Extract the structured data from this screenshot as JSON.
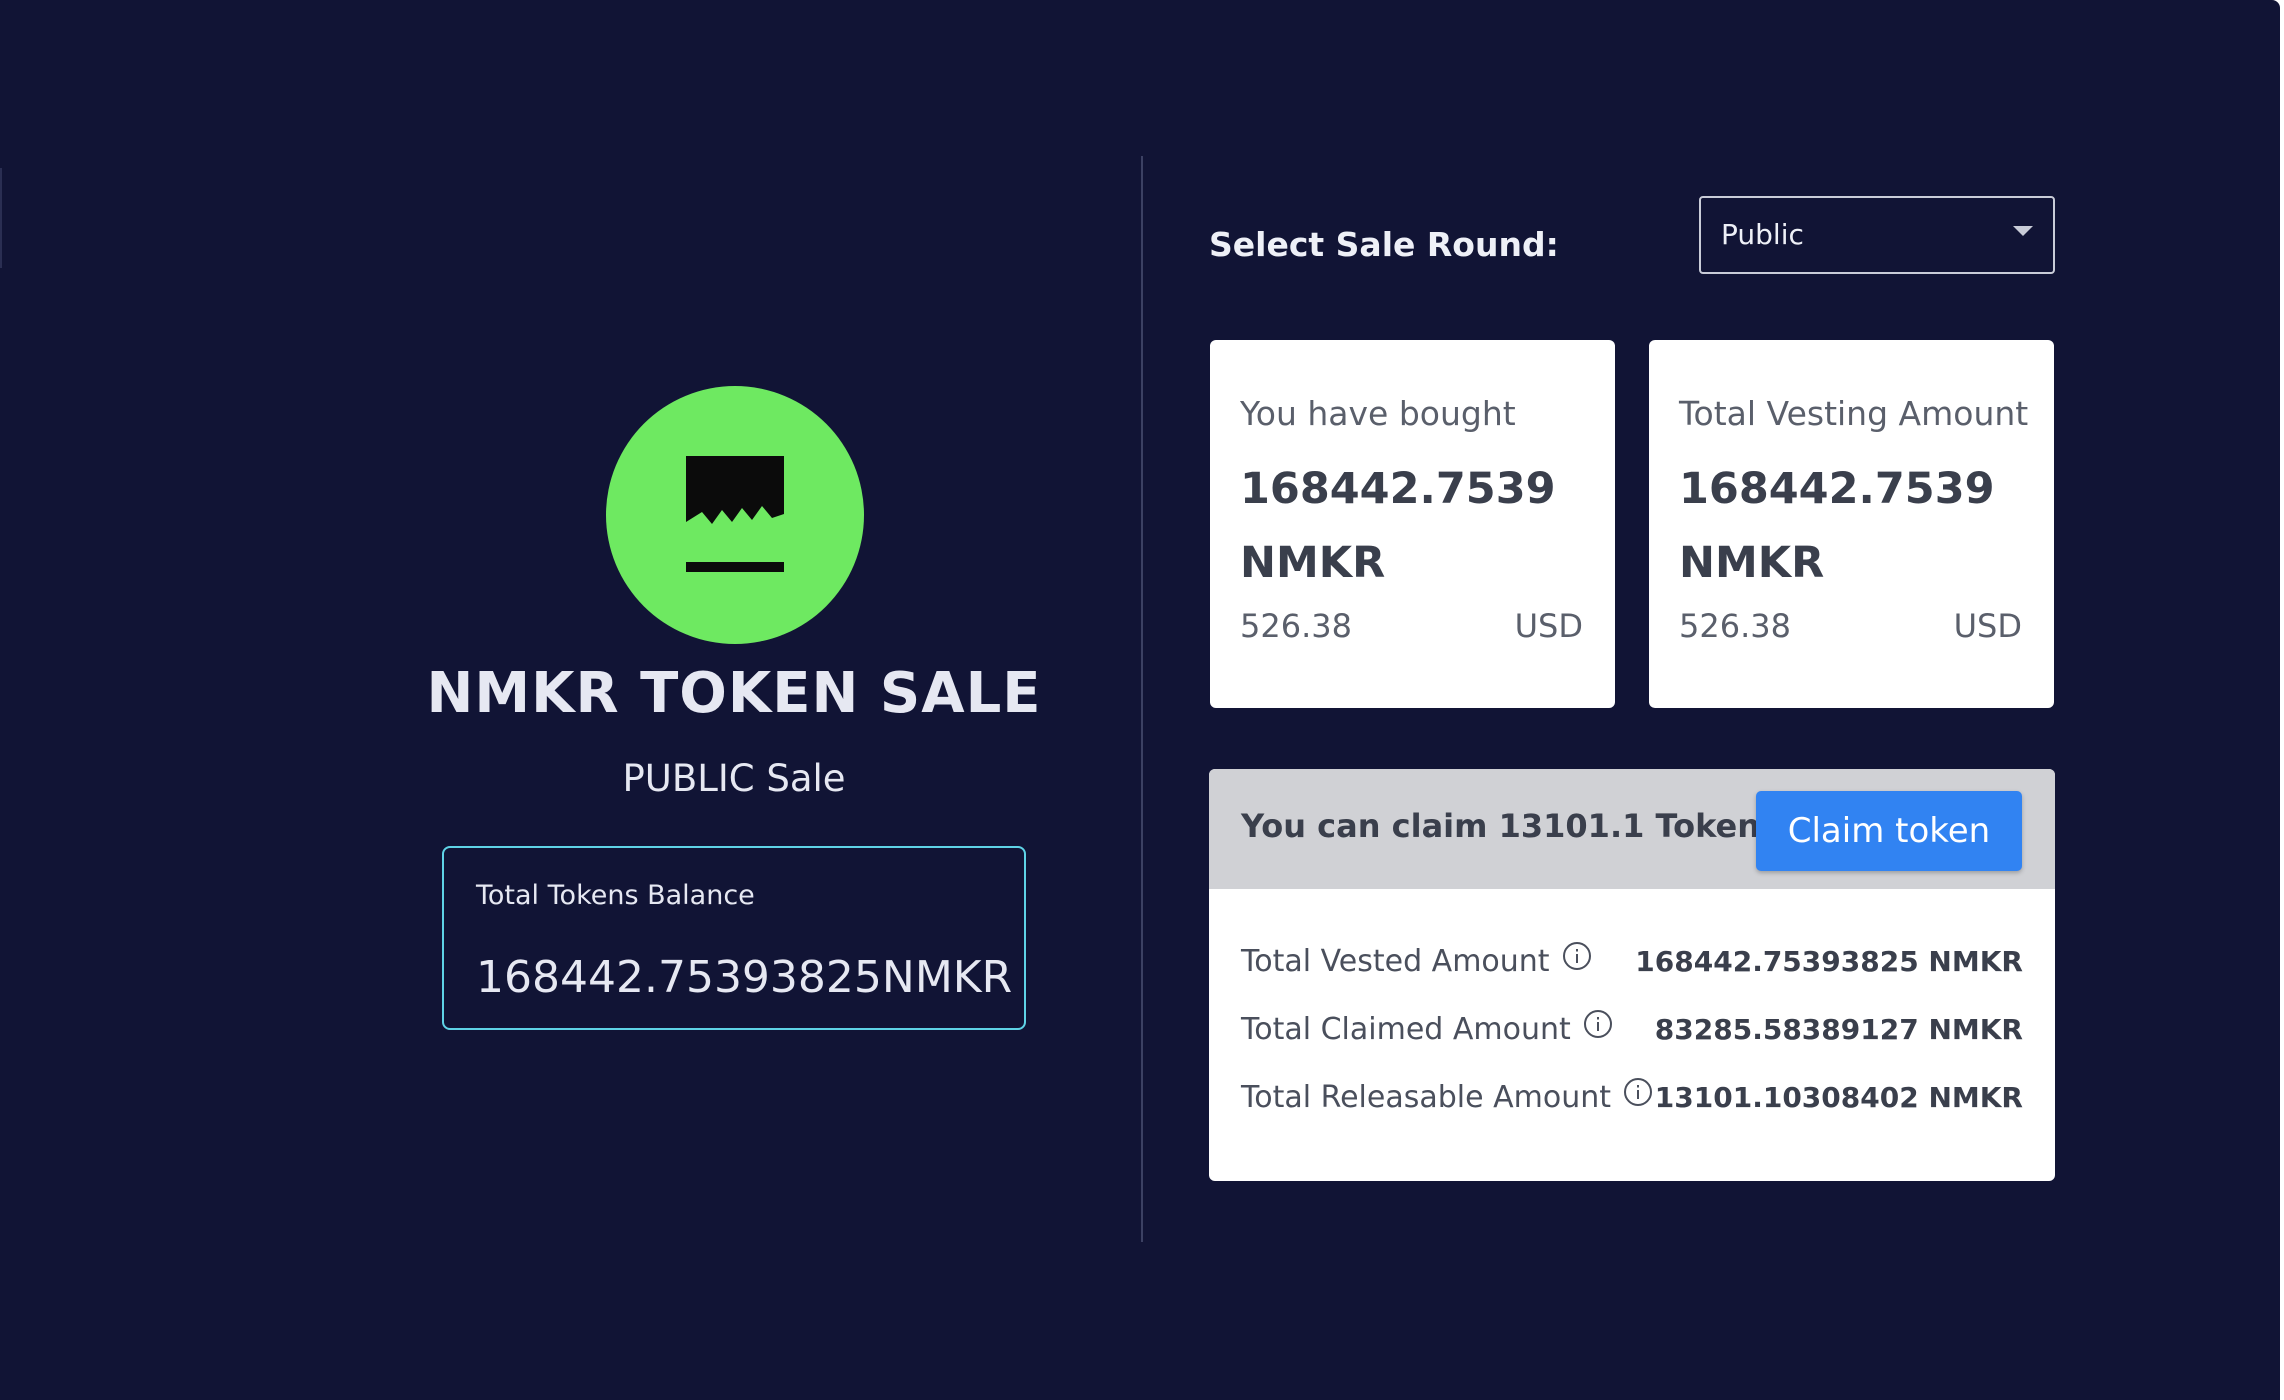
{
  "colors": {
    "background": "#111435",
    "logo_green": "#6ee961",
    "balance_border": "#5fd3e6",
    "claim_button": "#3183f2",
    "card_background": "#ffffff",
    "claim_header": "#d0d1d5"
  },
  "sale": {
    "logo_icon": "nmkr-logo-icon",
    "title": "NMKR TOKEN SALE",
    "subtitle": "PUBLIC Sale",
    "balance": {
      "label": "Total Tokens Balance",
      "value": "168442.75393825NMKR"
    }
  },
  "round": {
    "label": "Select Sale Round:",
    "selected": "Public",
    "caret_icon": "caret-down-icon"
  },
  "cards": {
    "bought": {
      "label": "You have bought",
      "amount": "168442.7539 NMKR",
      "usd_value": "526.38",
      "usd_unit": "USD"
    },
    "vesting": {
      "label": "Total Vesting Amount",
      "amount": "168442.7539 NMKR",
      "usd_value": "526.38",
      "usd_unit": "USD"
    }
  },
  "claim": {
    "text": "You can claim 13101.1 Tokens",
    "button_label": "Claim token",
    "rows": [
      {
        "label": "Total Vested Amount",
        "value": "168442.75393825 NMKR",
        "icon": "info-icon"
      },
      {
        "label": "Total Claimed Amount",
        "value": "83285.58389127 NMKR",
        "icon": "info-icon"
      },
      {
        "label": "Total Releasable Amount",
        "value": "13101.10308402 NMKR",
        "icon": "info-icon"
      }
    ]
  }
}
